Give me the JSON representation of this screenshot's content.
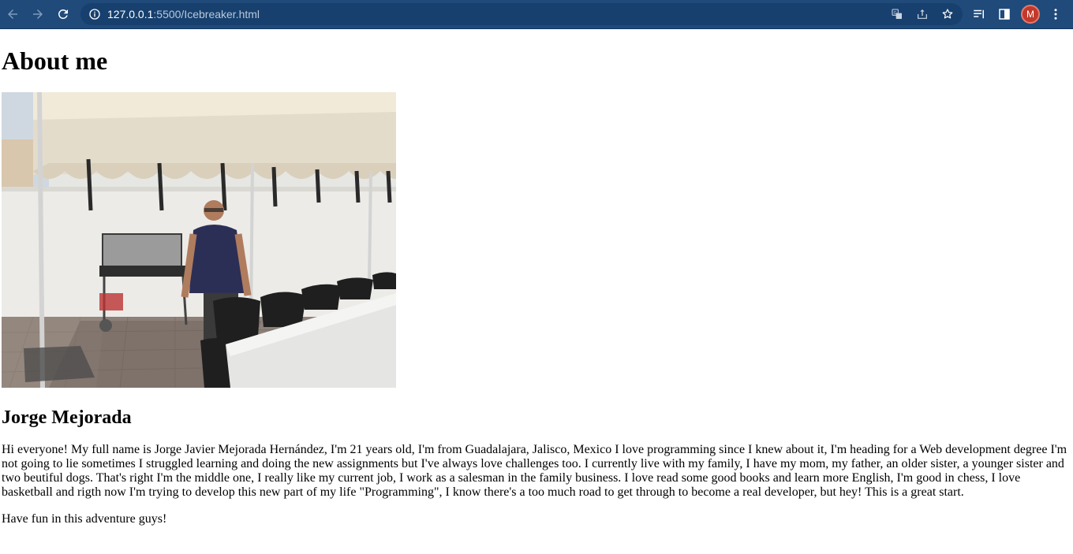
{
  "browser": {
    "url_host": "127.0.0.1",
    "url_path": ":5500/Icebreaker.html",
    "profile_initial": "M",
    "icons": {
      "back": "back-arrow-icon",
      "forward": "forward-arrow-icon",
      "reload": "reload-icon",
      "site_info": "info-icon",
      "translate": "translate-icon",
      "share": "share-icon",
      "bookmark": "star-icon",
      "reading_list": "reading-list-icon",
      "side_panel": "side-panel-icon",
      "menu": "kebab-menu-icon"
    }
  },
  "page": {
    "heading": "About me",
    "photo_alt": "",
    "name": "Jorge Mejorada",
    "intro": "Hi everyone! My full name is Jorge Javier Mejorada Hernández, I'm 21 years old, I'm from Guadalajara, Jalisco, Mexico I love programming since I knew about it, I'm heading for a Web development degree I'm not going to lie sometimes I struggled learning and doing the new assignments but I've always love challenges too. I currently live with my family, I have my mom, my father, an older sister, a younger sister and two beutiful dogs. That's right I'm the middle one, I really like my current job, I work as a salesman in the family business. I love read some good books and learn more English, I'm good in chess, I love basketball and rigth now I'm trying to develop this new part of my life \"Programming\", I know there's a too much road to get through to become a real developer, but hey! This is a great start.",
    "closing": "Have fun in this adventure guys!"
  },
  "colors": {
    "chrome_bg": "#1f4a7a",
    "omnibox_bg": "#17406e",
    "avatar_bg": "#c0392b"
  }
}
